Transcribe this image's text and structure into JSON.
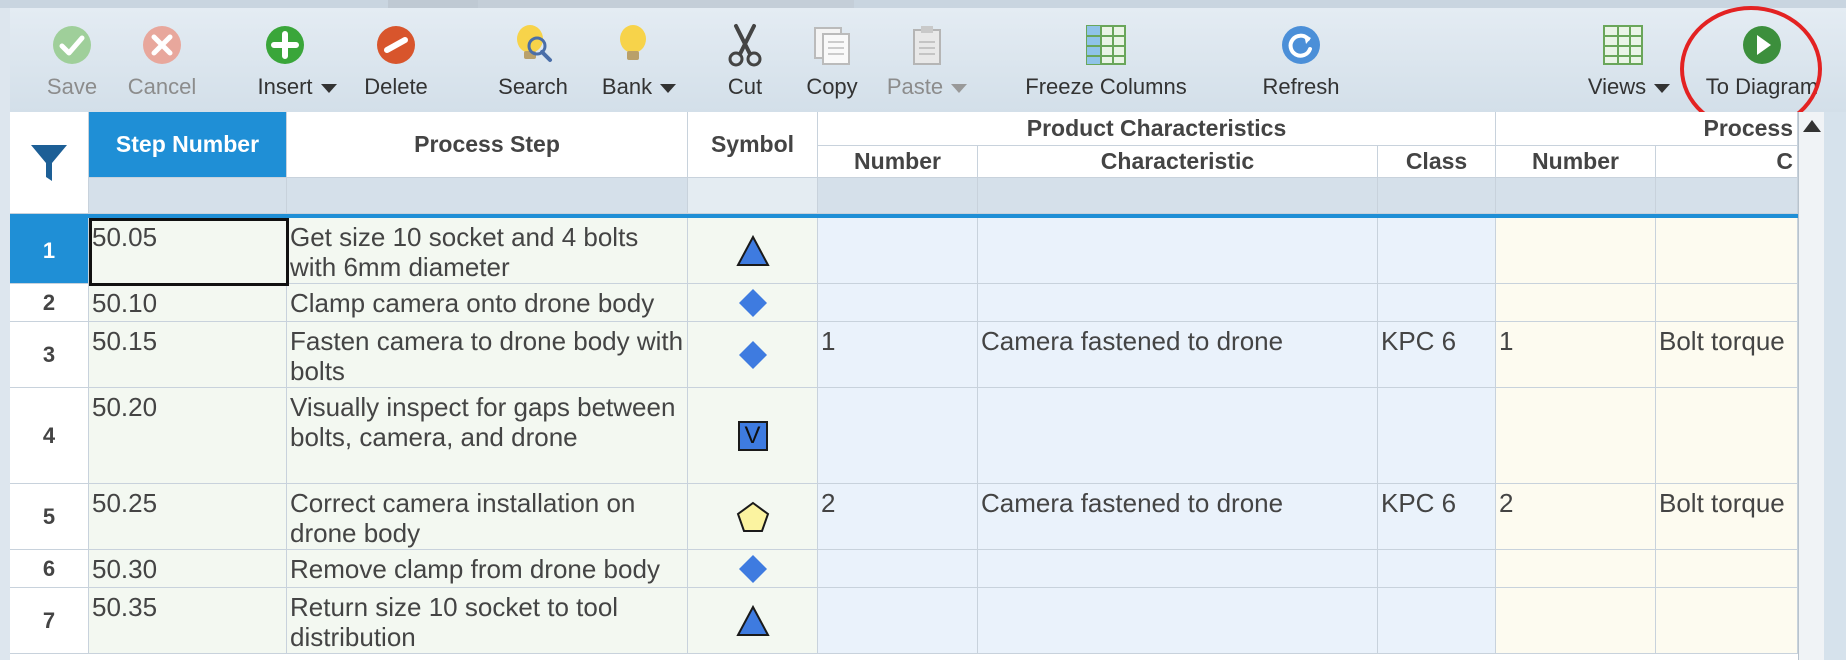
{
  "toolbar": {
    "save": {
      "label": "Save",
      "icon": "check-circle-icon"
    },
    "cancel": {
      "label": "Cancel",
      "icon": "x-circle-icon"
    },
    "insert": {
      "label": "Insert",
      "icon": "plus-circle-icon"
    },
    "delete": {
      "label": "Delete",
      "icon": "minus-circle-icon"
    },
    "search": {
      "label": "Search",
      "icon": "lightbulb-magnifier-icon"
    },
    "bank": {
      "label": "Bank",
      "icon": "lightbulb-icon"
    },
    "cut": {
      "label": "Cut",
      "icon": "scissors-icon"
    },
    "copy": {
      "label": "Copy",
      "icon": "copy-icon"
    },
    "paste": {
      "label": "Paste",
      "icon": "clipboard-icon"
    },
    "freeze": {
      "label": "Freeze Columns",
      "icon": "freeze-columns-icon"
    },
    "refresh": {
      "label": "Refresh",
      "icon": "refresh-icon"
    },
    "views": {
      "label": "Views",
      "icon": "grid-view-icon"
    },
    "to_diagram": {
      "label": "To Diagram",
      "icon": "play-circle-icon"
    }
  },
  "grid": {
    "headers": {
      "step_number": "Step Number",
      "process_step": "Process Step",
      "symbol": "Symbol",
      "product_characteristics": "Product Characteristics",
      "process_group": "Process",
      "pc_number": "Number",
      "pc_characteristic": "Characteristic",
      "pc_class": "Class",
      "pr_number": "Number",
      "pr_char": "C"
    },
    "rows": [
      {
        "num": "1",
        "step": "50.05",
        "process": "Get size 10 socket and 4 bolts with 6mm diameter",
        "symbol": "triangle",
        "pc_number": "",
        "pc_char": "",
        "pc_class": "",
        "pr_number": "",
        "pr_char": ""
      },
      {
        "num": "2",
        "step": "50.10",
        "process": "Clamp camera onto drone body",
        "symbol": "diamond",
        "pc_number": "",
        "pc_char": "",
        "pc_class": "",
        "pr_number": "",
        "pr_char": ""
      },
      {
        "num": "3",
        "step": "50.15",
        "process": "Fasten camera to drone body with bolts",
        "symbol": "diamond",
        "pc_number": "1",
        "pc_char": "Camera fastened to drone",
        "pc_class": "KPC 6",
        "pr_number": "1",
        "pr_char": "Bolt torque"
      },
      {
        "num": "4",
        "step": "50.20",
        "process": "Visually inspect for gaps between bolts, camera, and drone",
        "symbol": "inspect",
        "symbol_letter": "V",
        "pc_number": "",
        "pc_char": "",
        "pc_class": "",
        "pr_number": "",
        "pr_char": ""
      },
      {
        "num": "5",
        "step": "50.25",
        "process": "Correct camera installation on drone body",
        "symbol": "pentagon",
        "pc_number": "2",
        "pc_char": "Camera fastened to drone",
        "pc_class": "KPC 6",
        "pr_number": "2",
        "pr_char": "Bolt torque"
      },
      {
        "num": "6",
        "step": "50.30",
        "process": "Remove clamp from drone body",
        "symbol": "diamond",
        "pc_number": "",
        "pc_char": "",
        "pc_class": "",
        "pr_number": "",
        "pr_char": ""
      },
      {
        "num": "7",
        "step": "50.35",
        "process": "Return size 10 socket to tool distribution",
        "symbol": "triangle",
        "pc_number": "",
        "pc_char": "",
        "pc_class": "",
        "pr_number": "",
        "pr_char": ""
      }
    ]
  },
  "colors": {
    "accent": "#1f8fd6",
    "highlight_circle": "#e32222"
  }
}
